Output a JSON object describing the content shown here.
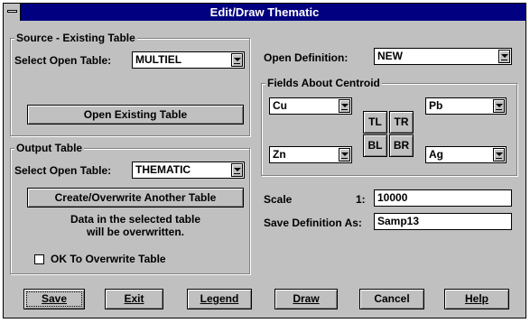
{
  "window": {
    "title": "Edit/Draw Thematic"
  },
  "source": {
    "group_label": "Source - Existing Table",
    "select_label": "Select Open Table:",
    "select_value": "MULTIEL",
    "open_button": "Open Existing Table"
  },
  "output": {
    "group_label": "Output Table",
    "select_label": "Select Open Table:",
    "select_value": "THEMATIC",
    "create_button": "Create/Overwrite Another Table",
    "warning_line1": "Data in the selected table",
    "warning_line2": "will be overwritten.",
    "ok_checkbox_label": "OK To Overwrite Table",
    "ok_checked": false
  },
  "definition": {
    "label": "Open Definition:",
    "value": "NEW"
  },
  "centroid": {
    "group_label": "Fields About Centroid",
    "top_left": "Cu",
    "top_right": "Pb",
    "bottom_left": "Zn",
    "bottom_right": "Ag",
    "btn_tl": "TL",
    "btn_tr": "TR",
    "btn_bl": "BL",
    "btn_br": "BR"
  },
  "scale": {
    "label": "Scale",
    "prefix": "1:",
    "value": "10000"
  },
  "save_definition": {
    "label": "Save Definition As:",
    "value": "Samp13"
  },
  "buttons": {
    "save": "Save",
    "exit": "Exit",
    "legend": "Legend",
    "draw": "Draw",
    "cancel": "Cancel",
    "help": "Help"
  }
}
